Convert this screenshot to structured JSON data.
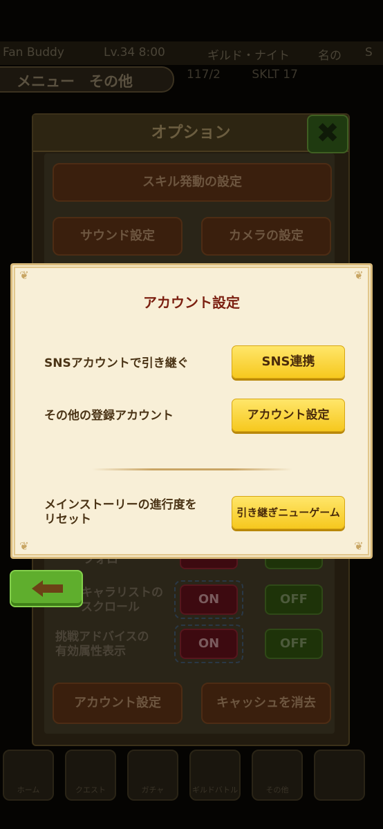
{
  "background": {
    "topbar_items": [
      "Fan Buddy",
      "Lv.34 8:00",
      "ギルド・ナイト",
      "名の",
      "S"
    ],
    "breadcrumb": "メニュー　その他",
    "status_text": "117/2",
    "status_text2": "SKLT 17",
    "options": {
      "title": "オプション",
      "close_label": "✖",
      "skill_button": "スキル発動の設定",
      "sound_button": "サウンド設定",
      "camera_button": "カメラの設定",
      "hidden_row_label": "フォロ",
      "chara_scroll_label": "キャラリストの\nスクロール",
      "advice_label": "挑戦アドバイスの\n有効属性表示",
      "on_label": "ON",
      "off_label": "OFF",
      "account_button": "アカウント設定",
      "cache_button": "キャッシュを消去"
    },
    "bottom_icons": [
      "ホーム",
      "クエスト",
      "ガチャ",
      "ギルドバトル",
      "その他",
      ""
    ]
  },
  "dialog": {
    "title": "アカウント設定",
    "rows": [
      {
        "label": "SNSアカウントで引き継ぐ",
        "button": "SNS連携"
      },
      {
        "label": "その他の登録アカウント",
        "button": "アカウント設定"
      },
      {
        "label": "メインストーリーの進行度を\nリセット",
        "button": "引き継ぎニューゲーム"
      }
    ]
  },
  "colors": {
    "dialog_bg": "#f8efd7",
    "title": "#7b1f10",
    "button_yellow": "#f6c81e",
    "back_green": "#5fae2d"
  },
  "icons": {
    "close": "close-x-icon",
    "back": "back-arrow-icon"
  }
}
